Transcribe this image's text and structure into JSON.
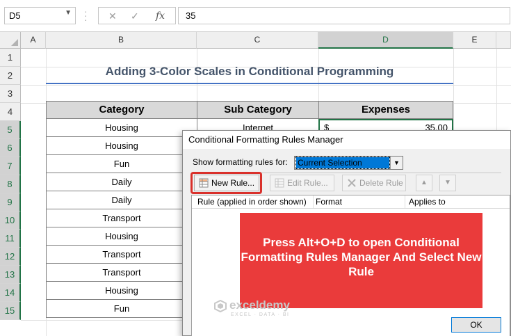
{
  "formula_bar": {
    "name_box": "D5",
    "cancel_symbol": "✕",
    "enter_symbol": "✓",
    "fx_symbol": "fx",
    "formula": "35"
  },
  "columns": [
    "A",
    "B",
    "C",
    "D",
    "E"
  ],
  "rows": [
    "1",
    "2",
    "3",
    "4",
    "5",
    "6",
    "7",
    "8",
    "9",
    "10",
    "11",
    "12",
    "13",
    "14",
    "15"
  ],
  "selected_cell": "D5",
  "sheet": {
    "title": "Adding 3-Color Scales in Conditional Programming",
    "headers": {
      "category": "Category",
      "sub_category": "Sub Category",
      "expenses": "Expenses"
    },
    "categories": [
      "Housing",
      "Housing",
      "Fun",
      "Daily",
      "Daily",
      "Transport",
      "Housing",
      "Transport",
      "Transport",
      "Housing",
      "Fun"
    ],
    "first_sub_category": "Internet",
    "first_expense_currency": "$",
    "first_expense_value": "35.00"
  },
  "dialog": {
    "title": "Conditional Formatting Rules Manager",
    "show_label": "Show formatting rules for:",
    "show_value": "Current Selection",
    "buttons": {
      "new_rule": "New Rule...",
      "edit_rule": "Edit Rule...",
      "delete_rule": "Delete Rule"
    },
    "list_columns": [
      "Rule (applied in order shown)",
      "Format",
      "Applies to"
    ],
    "ok_label": "OK"
  },
  "callout": {
    "text": "Press Alt+O+D to open Conditional Formatting Rules Manager And Select New Rule"
  },
  "watermark": {
    "name": "exceldemy",
    "tagline": "EXCEL · DATA · BI"
  },
  "colors": {
    "excel_green": "#217346",
    "title_text": "#44546a",
    "title_rule": "#4472c4",
    "header_fill": "#d9d9d9",
    "callout_fill": "#ea3b3b",
    "highlight_frame": "#d9302b",
    "selection_blue": "#0078d7"
  }
}
